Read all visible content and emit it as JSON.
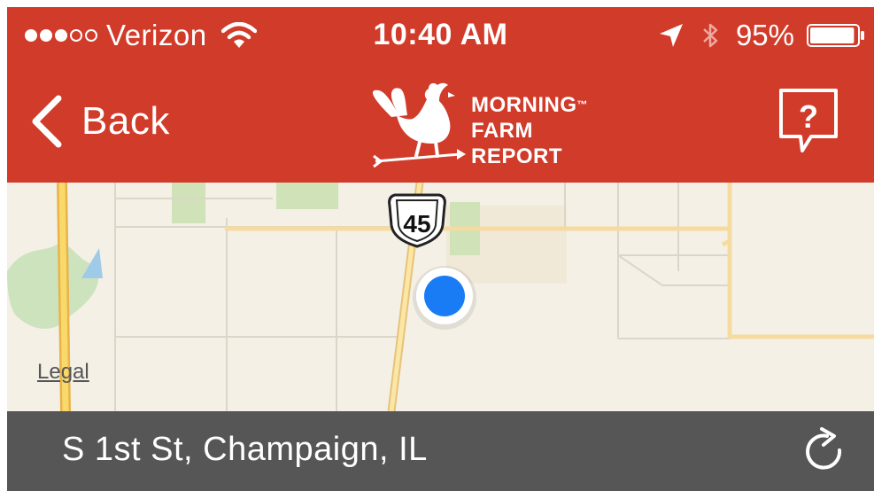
{
  "status_bar": {
    "carrier": "Verizon",
    "signal_bars_filled": 3,
    "signal_bars_total": 5,
    "time": "10:40 AM",
    "battery_percent": "95%",
    "battery_level": 0.95,
    "icons": [
      "wifi-icon",
      "location-arrow-icon",
      "bluetooth-icon",
      "battery-icon"
    ]
  },
  "nav": {
    "back_label": "Back",
    "logo_line1": "MORNING",
    "logo_tm": "™",
    "logo_line2": "FARM",
    "logo_line3": "REPORT",
    "help_icon": "question-speech-bubble-icon"
  },
  "map": {
    "highway_shield": "45",
    "legal_label": "Legal",
    "icons": [
      "current-location-dot"
    ]
  },
  "footer": {
    "location": "S 1st St, Champaign, IL",
    "refresh_icon": "refresh-icon"
  },
  "colors": {
    "brand_red": "#d13b2a",
    "footer_gray": "#565656",
    "map_bg": "#f4f0e6",
    "location_blue": "#1a7cf5"
  }
}
